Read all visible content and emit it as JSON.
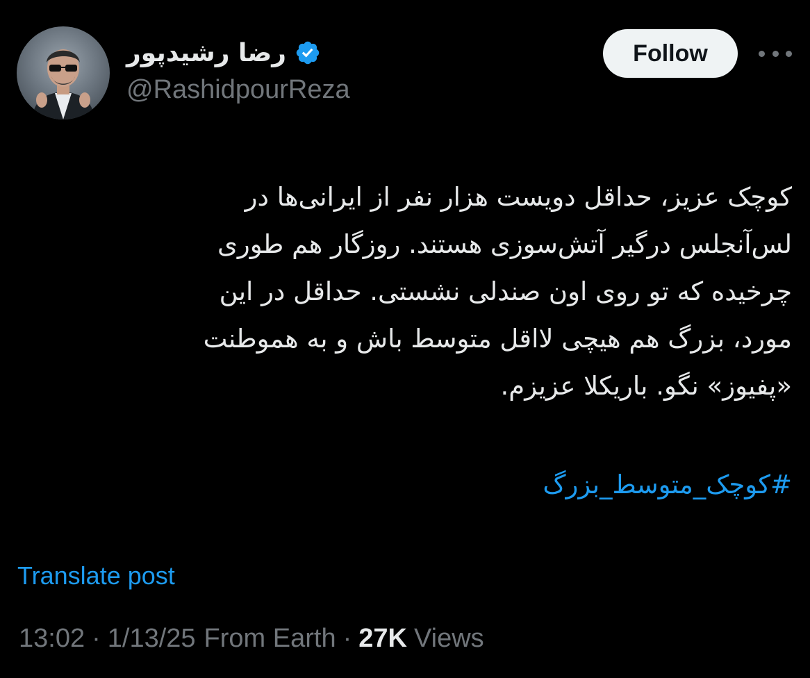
{
  "author": {
    "display_name": "رضا رشیدپور",
    "handle": "@RashidpourReza",
    "verified": true,
    "avatar": "profile-photo"
  },
  "actions": {
    "follow_label": "Follow",
    "more_icon": "more-horizontal-icon"
  },
  "post": {
    "lines": [
      "کوچک عزیز، حداقل دویست هزار نفر از ایرانی‌ها در",
      "لس‌آنجلس درگیر آتش‌سوزی هستند. روزگار هم طوری",
      "چرخیده که تو روی اون صندلی نشستی. حداقل در این",
      "مورد، بزرگ هم هیچی لااقل متوسط باش و به هموطنت",
      "«پفیوز» نگو. باریکلا عزیزم."
    ],
    "hashtag": "#کوچک_متوسط_بزرگ"
  },
  "translate_label": "Translate post",
  "meta": {
    "time": "13:02",
    "date": "1/13/25",
    "location": "From Earth",
    "views_count": "27K",
    "views_label": "Views",
    "separator": "·"
  },
  "colors": {
    "background": "#000000",
    "text": "#e7e9ea",
    "secondary": "#71767b",
    "link": "#1d9bf0",
    "verified": "#1d9bf0",
    "button_bg": "#eff3f4"
  }
}
